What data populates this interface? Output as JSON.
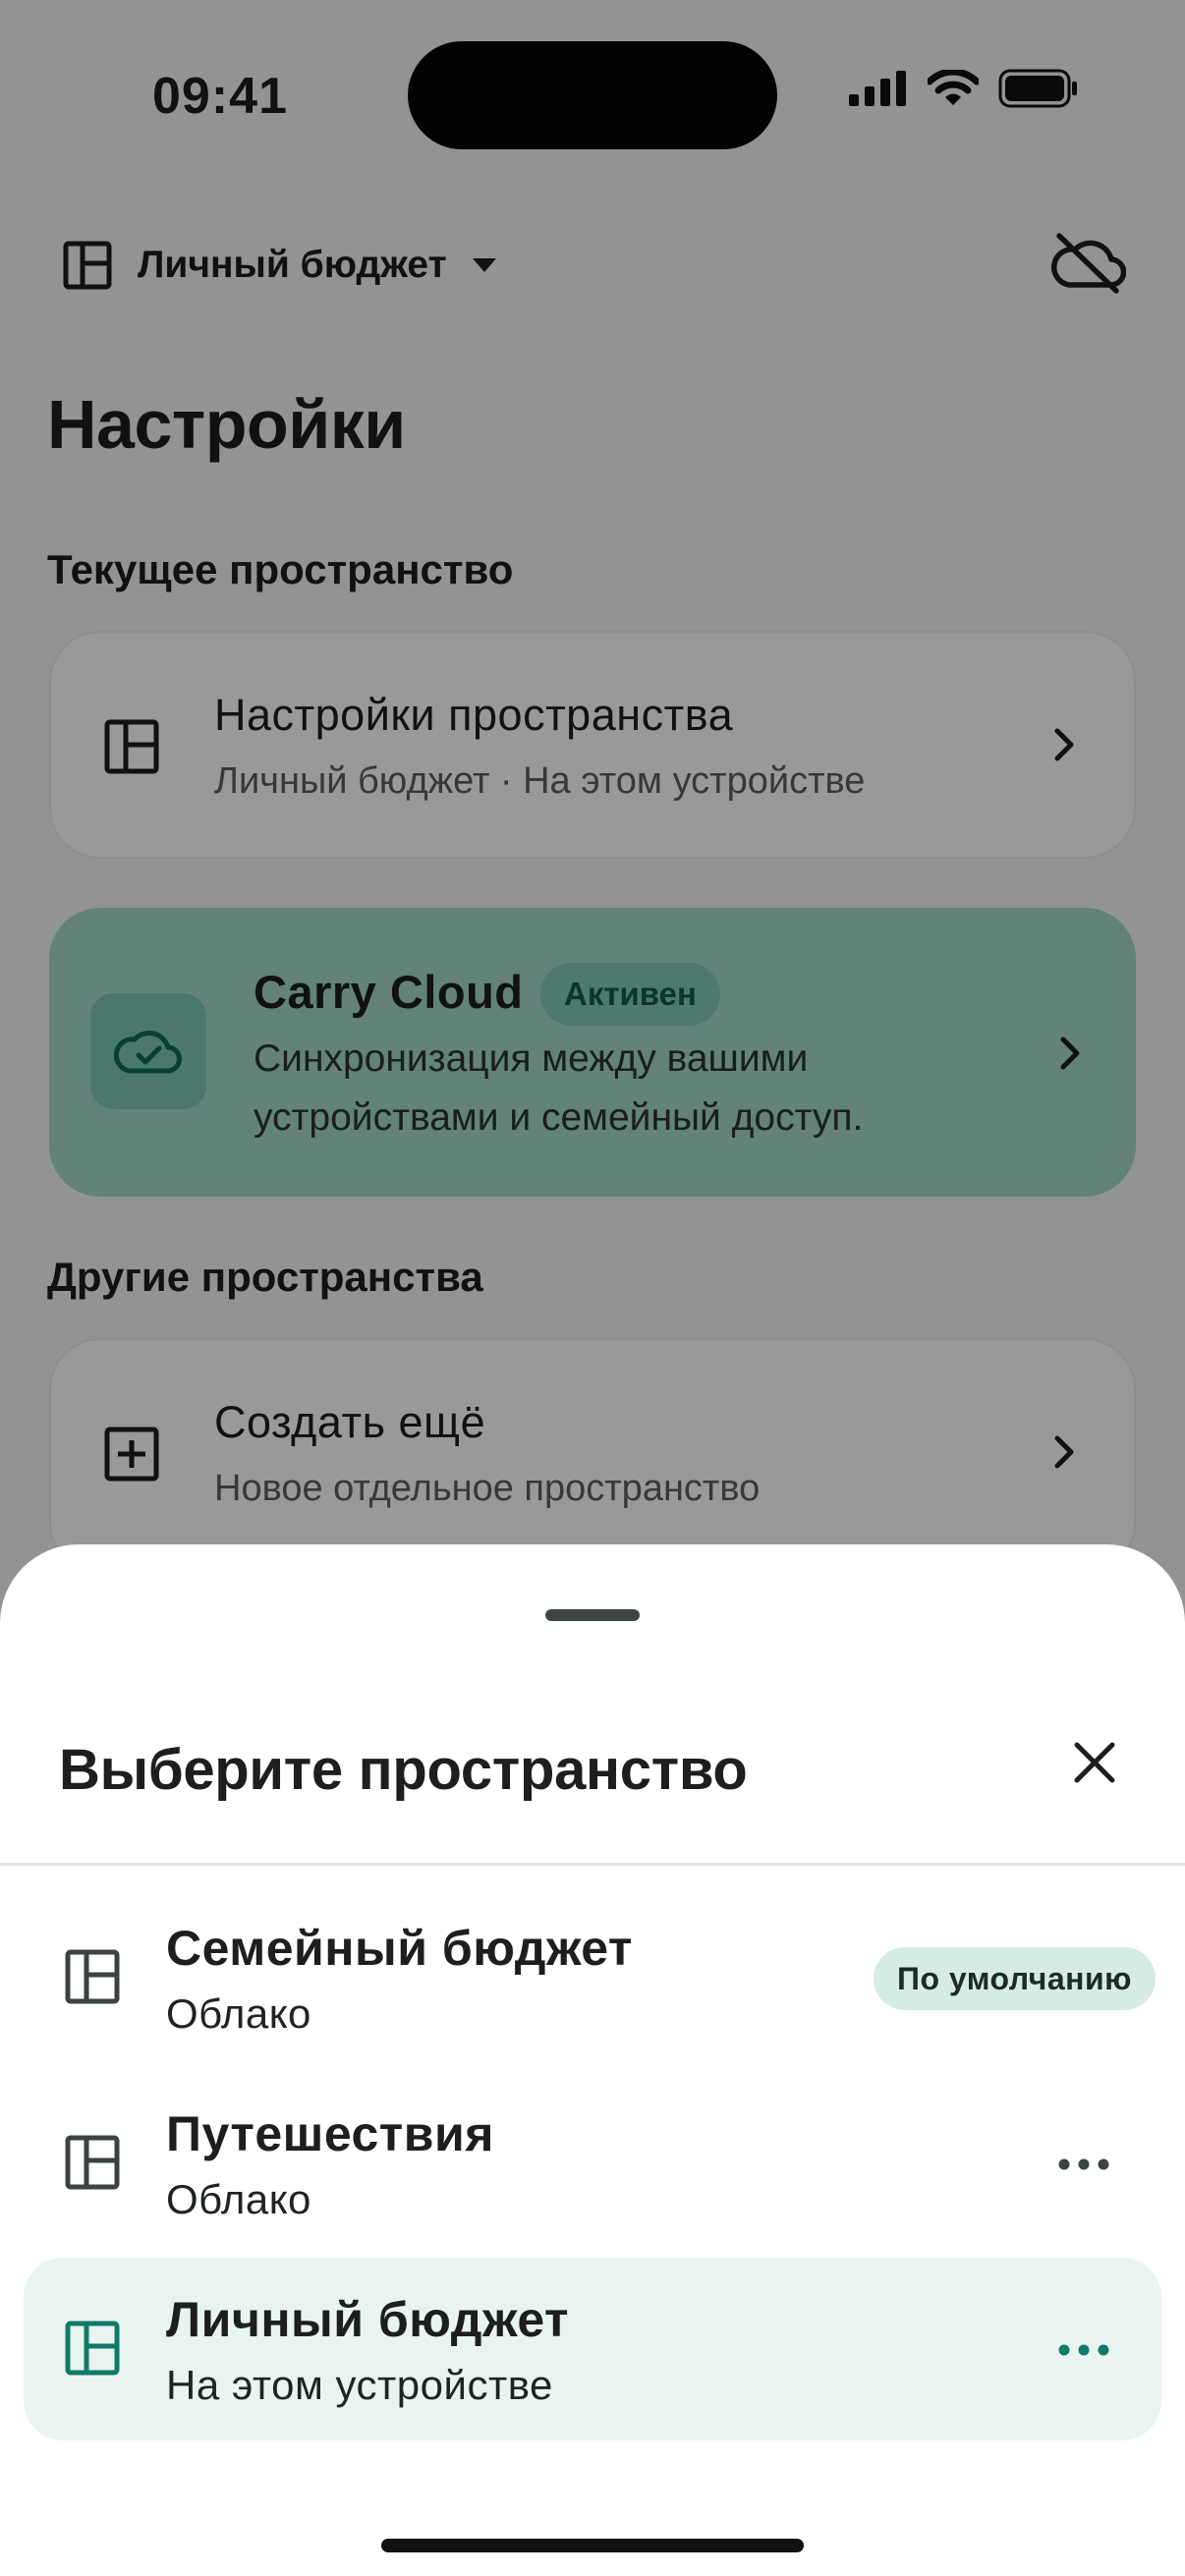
{
  "status_bar": {
    "time": "09:41"
  },
  "header": {
    "space_name": "Личный бюджет"
  },
  "page": {
    "title": "Настройки"
  },
  "current_space": {
    "section_label": "Текущее пространство",
    "settings_card": {
      "title": "Настройки пространства",
      "subtitle": "Личный бюджет · На этом устройстве"
    },
    "cloud_card": {
      "title": "Carry Cloud",
      "badge": "Активен",
      "line1": "Синхронизация между вашими",
      "line2": "устройствами и семейный доступ."
    }
  },
  "other_spaces": {
    "section_label": "Другие пространства",
    "create_card": {
      "title": "Создать ещё",
      "subtitle": "Новое отдельное пространство"
    }
  },
  "sheet": {
    "title": "Выберите пространство",
    "items": [
      {
        "title": "Семейный бюджет",
        "subtitle": "Облако",
        "badge": "По умолчанию",
        "selected": false
      },
      {
        "title": "Путешествия",
        "subtitle": "Облако",
        "selected": false
      },
      {
        "title": "Личный бюджет",
        "subtitle": "На этом устройстве",
        "selected": true
      }
    ]
  },
  "colors": {
    "accent": "#0f7a68",
    "cloud_card_bg": "#a3d9cc",
    "selected_row_bg": "#e9f4f1"
  },
  "icons": [
    "signal-icon",
    "wifi-icon",
    "battery-icon",
    "space-layout-icon",
    "dropdown-caret-icon",
    "cloud-off-icon",
    "chevron-right-icon",
    "cloud-check-icon",
    "add-box-icon",
    "close-icon",
    "more-horizontal-icon"
  ]
}
